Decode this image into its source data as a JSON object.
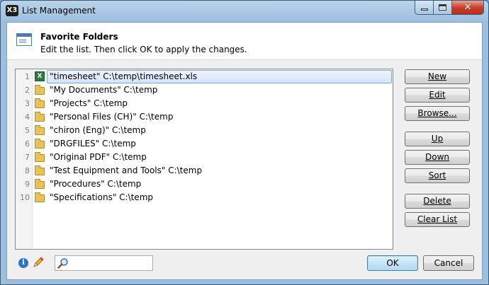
{
  "window": {
    "title": "List Management",
    "app_icon_label": "X3"
  },
  "header": {
    "title": "Favorite Folders",
    "description": "Edit the list. Then click OK to apply the changes."
  },
  "list": {
    "items": [
      {
        "num": "1",
        "text": "\"timesheet\" C:\\temp\\timesheet.xls",
        "icon": "excel-file-icon",
        "selected": true
      },
      {
        "num": "2",
        "text": "\"My Documents\" C:\\temp",
        "icon": "folder-icon"
      },
      {
        "num": "3",
        "text": "\"Projects\" C:\\temp",
        "icon": "folder-icon"
      },
      {
        "num": "4",
        "text": "\"Personal Files (CH)\" C:\\temp",
        "icon": "folder-icon"
      },
      {
        "num": "5",
        "text": "\"chiron (Eng)\" C:\\temp",
        "icon": "folder-icon"
      },
      {
        "num": "6",
        "text": "\"DRGFILES\" C:\\temp",
        "icon": "folder-icon"
      },
      {
        "num": "7",
        "text": "\"Original PDF\" C:\\temp",
        "icon": "folder-icon"
      },
      {
        "num": "8",
        "text": "\"Test Equipment and Tools\" C:\\temp",
        "icon": "folder-icon"
      },
      {
        "num": "9",
        "text": "\"Procedures\" C:\\temp",
        "icon": "folder-icon"
      },
      {
        "num": "10",
        "text": "\"Specifications\" C:\\temp",
        "icon": "folder-icon"
      }
    ]
  },
  "buttons": {
    "new": "New",
    "edit": "Edit",
    "browse": "Browse...",
    "up": "Up",
    "down": "Down",
    "sort": "Sort",
    "delete": "Delete",
    "clear_list": "Clear List",
    "ok": "OK",
    "cancel": "Cancel"
  },
  "search": {
    "value": "",
    "placeholder": ""
  },
  "icons": {
    "info": "info-icon",
    "pencil": "pencil-icon",
    "search": "search-icon"
  },
  "colors": {
    "selection_border": "#7da2ce",
    "folder": "#e7c25a",
    "excel": "#2f7a3a",
    "close_button": "#c7402a"
  }
}
